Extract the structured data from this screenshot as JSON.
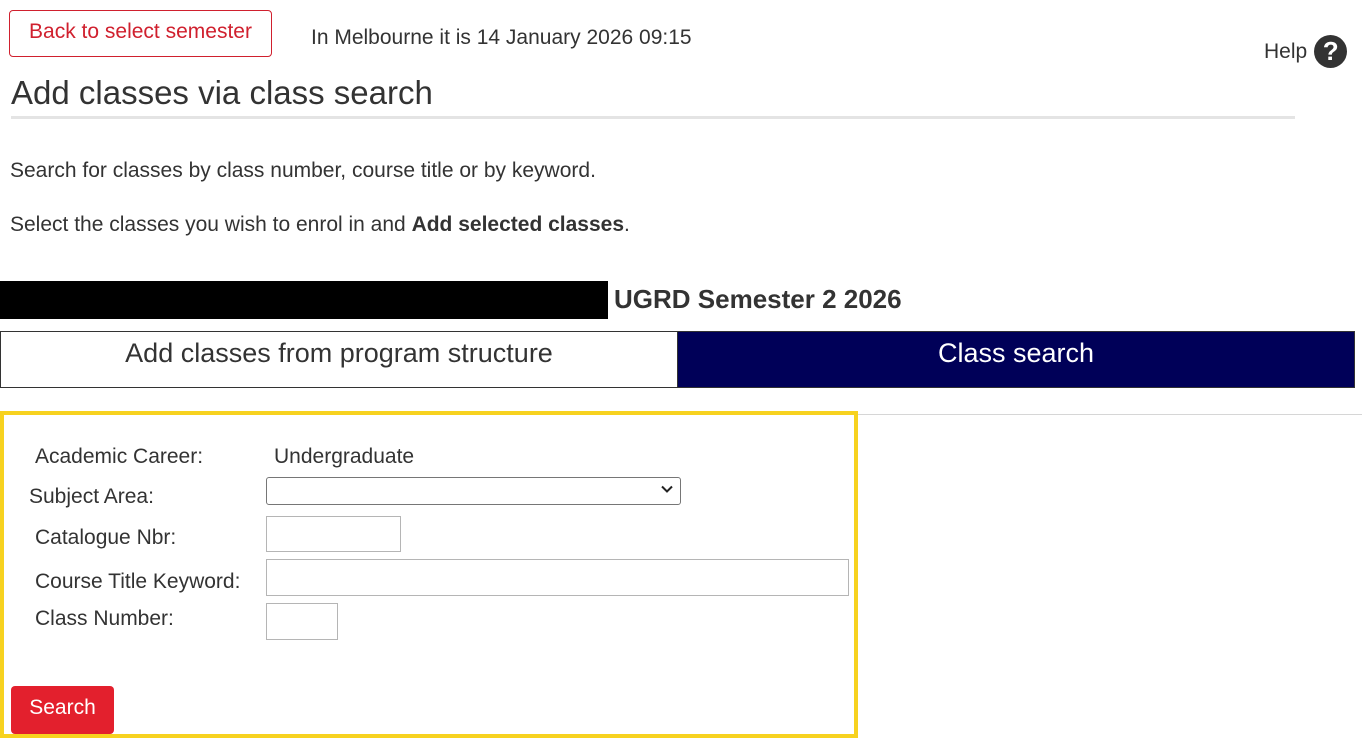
{
  "header": {
    "back_button": "Back to select semester",
    "clock_text": "In Melbourne it is 14 January 2026 09:15",
    "help_label": "Help",
    "help_icon": "?"
  },
  "page": {
    "title": "Add classes via class search",
    "instruction_1": "Search for classes by class number, course title or by keyword.",
    "instruction_2_prefix": "Select the classes you wish to enrol in and ",
    "instruction_2_bold": "Add selected classes",
    "instruction_2_suffix": "."
  },
  "term": {
    "label": "UGRD Semester 2 2026"
  },
  "tabs": [
    {
      "label": "Add classes from program structure",
      "active": false
    },
    {
      "label": "Class search",
      "active": true
    }
  ],
  "search_form": {
    "academic_career_label": "Academic Career:",
    "academic_career_value": "Undergraduate",
    "subject_area_label": "Subject Area:",
    "subject_area_value": "",
    "catalogue_nbr_label": "Catalogue Nbr:",
    "catalogue_nbr_value": "",
    "course_title_label": "Course Title Keyword:",
    "course_title_value": "",
    "class_number_label": "Class Number:",
    "class_number_value": "",
    "search_button": "Search"
  },
  "colors": {
    "accent_red": "#e3202d",
    "active_tab": "#000058",
    "highlight_border": "#f7d21f"
  }
}
